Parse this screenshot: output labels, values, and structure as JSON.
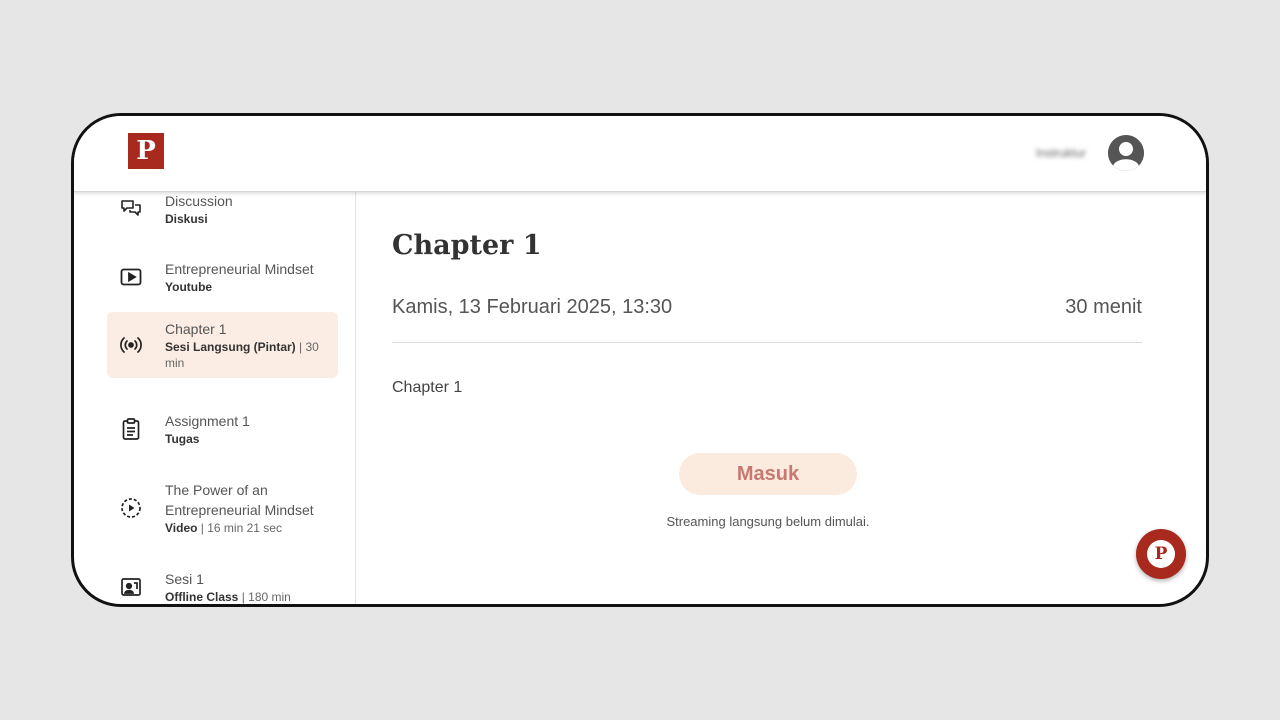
{
  "header": {
    "logo_letter": "P",
    "username": "Instruktur"
  },
  "sidebar": {
    "items": [
      {
        "title": "Discussion",
        "type": "Diskusi",
        "meta": "",
        "icon": "discussion-icon"
      },
      {
        "title": "Entrepreneurial Mindset",
        "type": "Youtube",
        "meta": "",
        "icon": "youtube-play-icon"
      },
      {
        "title": "Chapter 1",
        "type": "Sesi Langsung (Pintar)",
        "meta": " | 30 min",
        "icon": "live-broadcast-icon",
        "active": true
      },
      {
        "title": "Assignment 1",
        "type": "Tugas",
        "meta": "",
        "icon": "clipboard-icon"
      },
      {
        "title": "The Power of an Entrepreneurial Mindset",
        "type": "Video",
        "meta": " | 16 min 21 sec",
        "icon": "video-play-icon"
      },
      {
        "title": "Sesi 1",
        "type": "Offline Class",
        "meta": " | 180 min",
        "icon": "classroom-icon"
      }
    ]
  },
  "main": {
    "title": "Chapter 1",
    "date": "Kamis, 13 Februari 2025, 13:30",
    "duration": "30 menit",
    "description": "Chapter 1",
    "join_label": "Masuk",
    "status": "Streaming langsung belum dimulai."
  },
  "fab": {
    "letter": "P"
  },
  "colors": {
    "brand": "#a8291e",
    "active_bg": "#fbede3",
    "button_bg": "#fbebdf",
    "button_text": "#c77870",
    "background": "#e6e6e6"
  }
}
